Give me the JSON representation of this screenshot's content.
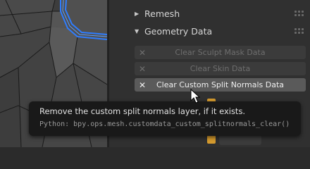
{
  "sections": {
    "remesh": {
      "label": "Remesh",
      "arrow": "▶"
    },
    "geometry_data": {
      "label": "Geometry Data",
      "arrow": "▼"
    }
  },
  "buttons": [
    {
      "label": "Clear Sculpt Mask Data",
      "icon": "✕",
      "state": "disabled"
    },
    {
      "label": "Clear Skin Data",
      "icon": "✕",
      "state": "disabled"
    },
    {
      "label": "Clear Custom Split Normals Data",
      "icon": "✕",
      "state": "hovered"
    }
  ],
  "tooltip": {
    "description": "Remove the custom split normals layer, if it exists.",
    "python": "Python: bpy.ops.mesh.customdata_custom_splitnormals_clear()"
  },
  "colors": {
    "panel_bg": "#303030",
    "viewport_bg": "#3d3d3d",
    "selection_blue": "#2f7dff",
    "checkbox_accent": "#d49a2e"
  }
}
